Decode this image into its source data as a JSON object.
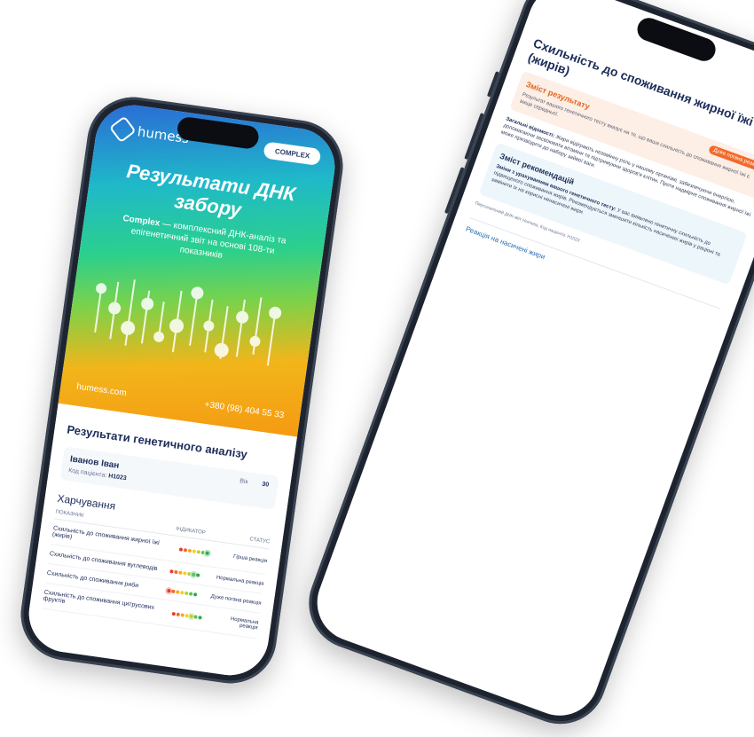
{
  "left_phone": {
    "brand": "humess",
    "badge": "COMPLEX",
    "hero_title": "Результати ДНК забору",
    "hero_sub_bold": "Complex",
    "hero_sub": " — комплексний ДНК-аналіз та епігенетичний звіт на основі 108-ти показників",
    "site": "humess.com",
    "phone": "+380 (98) 404 55 33",
    "report_title": "Результати генетичного аналізу",
    "patient_name": "Іванов Іван",
    "patient_code_label": "Код пацієнта:",
    "patient_code": "H1023",
    "age_label": "Вік",
    "age": "30",
    "section": "Харчування",
    "columns": [
      "ПОКАЗНИК",
      "ІНДИКАТОР",
      "СТАТУС"
    ],
    "rows": [
      {
        "name": "Схильність до споживання жирної їжі (жирів)",
        "status": "Гірша реакція"
      },
      {
        "name": "Схильність до споживання вуглеводів",
        "status": "Нормальна реакція"
      },
      {
        "name": "Схильність до споживання риби",
        "status": "Дуже погана реакція"
      },
      {
        "name": "Схильність до споживання цитрусових фруктів",
        "status": "Нормальна реакція"
      }
    ]
  },
  "right_phone": {
    "title": "Схильність до споживання жирної їжі (жирів)",
    "result_heading": "Зміст результату",
    "result_text": "Результат вашого генетичного тесту вказує на те, що ваша схильність до споживання жирної їжі є вище середньої.",
    "tag": "Дуже погана реакція",
    "para_bold": "Загальні відомості:",
    "para": "Жири відіграють незамінну роль у нашому організмі, забезпечуючи енергією, допомагаючи засвоювати вітаміни та підтримуючи здоров'я клітин. Проте надмірне споживання жирної їжі може призводити до набору зайвої ваги.",
    "rec_heading": "Зміст рекомендацій",
    "rec_bold": "Зміни з урахуванням вашого генетичного тесту:",
    "rec_text": "У вас виявлено генетичну схильність до підвищеного споживання жирів. Рекомендується зменшити кількість насичених жирів у раціоні та замінити їх на корисні ненасичені жири.",
    "footnote": "Персональний ДНК-звіт Humess, Код пацієнта: H1023",
    "section2": "Реакція на насичені жири"
  },
  "colors": {
    "navy": "#1c2d5a",
    "orange": "#f26a2a"
  }
}
